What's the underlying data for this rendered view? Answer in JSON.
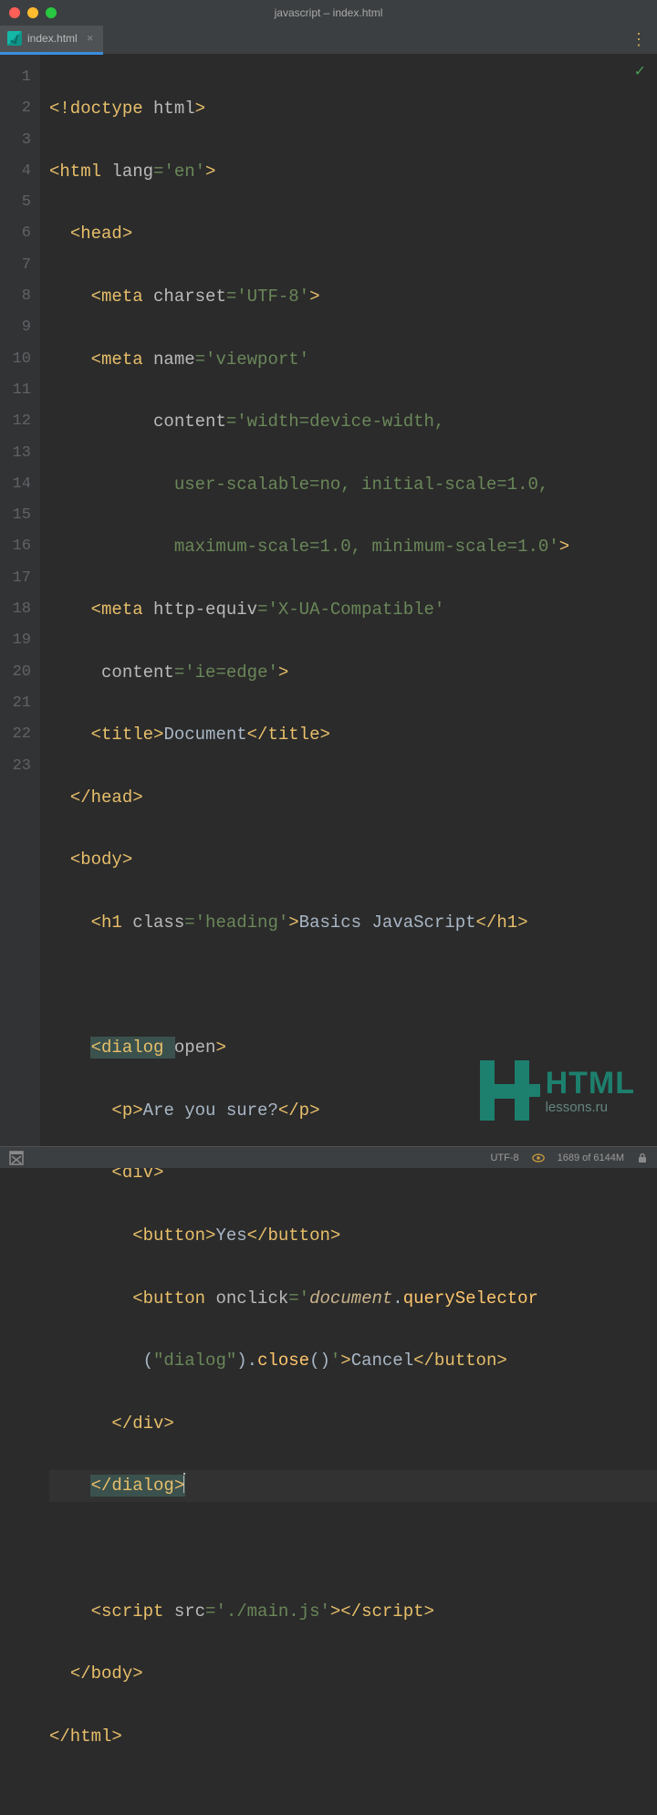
{
  "window": {
    "title": "javascript – index.html"
  },
  "tab": {
    "label": "index.html"
  },
  "gutter": [
    "1",
    "2",
    "3",
    "4",
    "5",
    "6",
    "7",
    "8",
    "9",
    "10",
    "11",
    "12",
    "13",
    "14",
    "15",
    "16",
    "17",
    "18",
    "19",
    "20",
    "21",
    "22",
    "23"
  ],
  "code": {
    "l1a": "<!doctype ",
    "l1b": "html",
    "l1c": ">",
    "l2a": "<html ",
    "l2b": "lang",
    "l2c": "=",
    "l2d": "'en'",
    "l2e": ">",
    "l3a": "<head>",
    "l4a": "<meta ",
    "l4b": "charset",
    "l4c": "=",
    "l4d": "'UTF-8'",
    "l4e": ">",
    "l5a": "<meta ",
    "l5b": "name",
    "l5c": "=",
    "l5d": "'viewport'",
    "l6a": "content",
    "l6b": "=",
    "l6c": "'width=device-width,",
    "l6d": " user-scalable=no, initial-scale=1.0,",
    "l6e": " maximum-scale=1.0, minimum-scale=1.0'",
    "l6f": ">",
    "l7a": "<meta ",
    "l7b": "http-equiv",
    "l7c": "=",
    "l7d": "'X-UA-Compatible'",
    "l7e": "content",
    "l7f": "=",
    "l7g": "'ie=edge'",
    "l7h": ">",
    "l8a": "<title>",
    "l8b": "Document",
    "l8c": "</title>",
    "l9a": "</head>",
    "l10a": "<body>",
    "l11a": "<h1 ",
    "l11b": "class",
    "l11c": "=",
    "l11d": "'heading'",
    "l11e": ">",
    "l11f": "Basics JavaScript",
    "l11g": "</h1>",
    "l13a": "<dialog ",
    "l13b": "open",
    "l13c": ">",
    "l14a": "<p>",
    "l14b": "Are you sure?",
    "l14c": "</p>",
    "l15a": "<div>",
    "l16a": "<button>",
    "l16b": "Yes",
    "l16c": "</button>",
    "l17a": "<button ",
    "l17b": "onclick",
    "l17c": "=",
    "l17d": "'",
    "l17e": "document",
    "l17f": ".",
    "l17g": "querySelector",
    "l17h": "(",
    "l17i": "\"dialog\"",
    "l17j": ").",
    "l17k": "close",
    "l17l": "()",
    "l17m": "'",
    "l17n": ">",
    "l17o": "Cancel",
    "l17p": "</button>",
    "l18a": "</div>",
    "l19a": "</dialog>",
    "l21a": "<script ",
    "l21b": "src",
    "l21c": "=",
    "l21d": "'./main.js'",
    "l21e": ">",
    "l21f": "</",
    "l21g": "script",
    "l21h": ">",
    "l22a": "</body>",
    "l23a": "</html>"
  },
  "status": {
    "encoding": "UTF-8",
    "memory": "1689 of 6144M"
  },
  "watermark": {
    "big": "HTML",
    "small": "lessons.ru"
  }
}
